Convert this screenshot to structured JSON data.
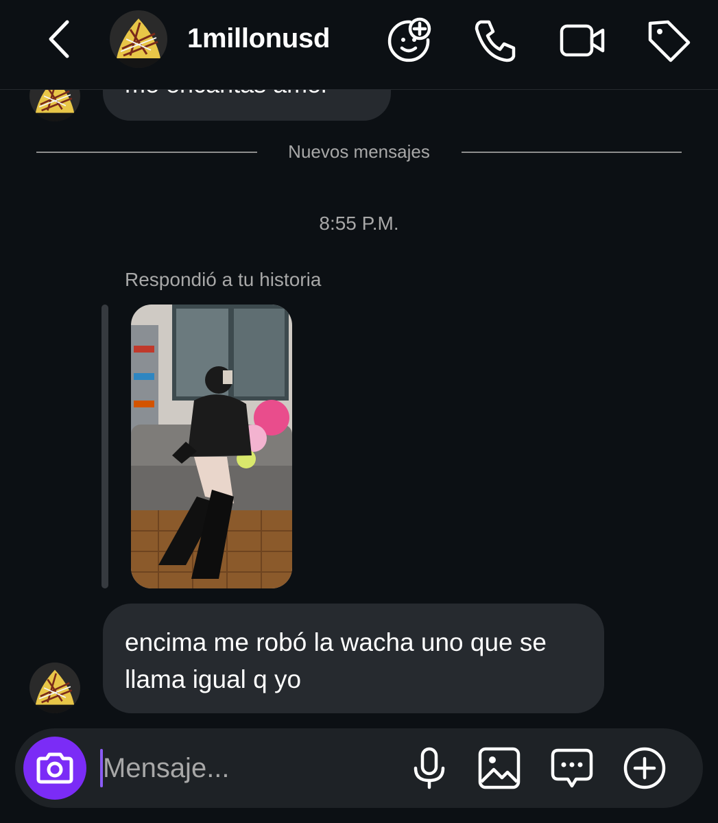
{
  "header": {
    "username": "1millonusd",
    "icons": [
      "back-chevron-icon",
      "avatar-add-icon",
      "phone-icon",
      "video-camera-icon",
      "tag-icon"
    ]
  },
  "thread": {
    "previous_message_partial": "me encantas amor",
    "divider_label": "Nuevos mensajes",
    "timestamp": "8:55 P.M.",
    "story_reply_label": "Respondió a tu historia",
    "message_text": "encima me robó la wacha uno que se llama igual q yo"
  },
  "composer": {
    "placeholder": "Mensaje...",
    "accent_color": "#7b2cf6",
    "icons": [
      "camera-icon",
      "microphone-icon",
      "gallery-icon",
      "sticker-chat-icon",
      "plus-circle-icon"
    ]
  },
  "colors": {
    "background": "#0c1014",
    "bubble": "#262a2f",
    "secondary_text": "#a8a8a8"
  }
}
